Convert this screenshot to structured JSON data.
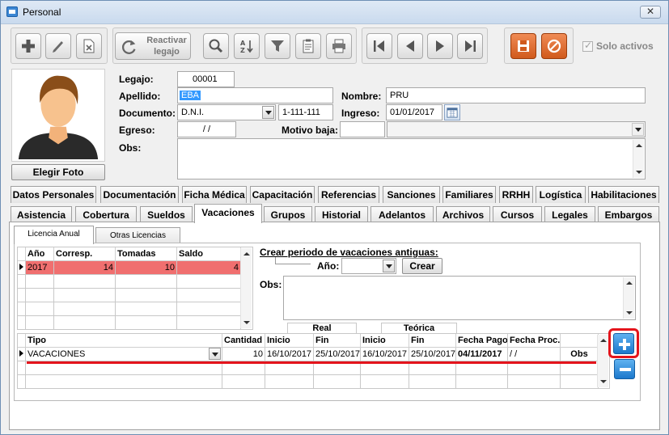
{
  "window": {
    "title": "Personal",
    "close": "✕"
  },
  "toolbar": {
    "reactivar_line1": "Reactivar",
    "reactivar_line2": "legajo",
    "solo_activos": "Solo activos"
  },
  "photo": {
    "button": "Elegir Foto"
  },
  "form": {
    "legajo_label": "Legajo:",
    "legajo_value": "00001",
    "apellido_label": "Apellido:",
    "apellido_value": "EBA",
    "nombre_label": "Nombre:",
    "nombre_value": "PRU",
    "documento_label": "Documento:",
    "documento_tipo": "D.N.I.",
    "documento_numero": "1-111-111",
    "ingreso_label": "Ingreso:",
    "ingreso_value": "01/01/2017",
    "egreso_label": "Egreso:",
    "egreso_value": "/  /",
    "motivo_label": "Motivo baja:",
    "obs_label": "Obs:"
  },
  "tabs_row1": [
    "Datos Personales",
    "Documentación",
    "Ficha Médica",
    "Capacitación",
    "Referencias",
    "Sanciones",
    "Familiares",
    "RRHH",
    "Logística",
    "Habilitaciones"
  ],
  "tabs_row2": [
    "Asistencia",
    "Cobertura",
    "Sueldos",
    "Vacaciones",
    "Grupos",
    "Historial",
    "Adelantos",
    "Archivos",
    "Cursos",
    "Legales",
    "Embargos"
  ],
  "subtabs": [
    "Licencia Anual",
    "Otras Licencias"
  ],
  "anual": {
    "headers": [
      "Año",
      "Corresp.",
      "Tomadas",
      "Saldo"
    ],
    "rows": [
      [
        "2017",
        "14",
        "10",
        "4"
      ]
    ]
  },
  "crear": {
    "title": "Crear periodo de vacaciones antiguas:",
    "ano_label": "Año:",
    "button": "Crear",
    "obs_label": "Obs:"
  },
  "detail": {
    "group_real": "Real",
    "group_teorica": "Teórica",
    "headers": [
      "Tipo",
      "Cantidad",
      "Inicio",
      "Fin",
      "Inicio",
      "Fin",
      "Fecha Pago",
      "Fecha Proc."
    ],
    "row": {
      "tipo": "VACACIONES",
      "cantidad": "10",
      "real_inicio": "16/10/2017",
      "real_fin": "25/10/2017",
      "teo_inicio": "16/10/2017",
      "teo_fin": "25/10/2017",
      "fecha_pago": "04/11/2017",
      "fecha_proc": "/  /",
      "obs": "Obs"
    }
  },
  "colors": {
    "selected_row": "#f06f6f",
    "highlight": "#e4141c",
    "accent_blue": "#1c78cc",
    "danger_orange": "#d05a1c"
  }
}
